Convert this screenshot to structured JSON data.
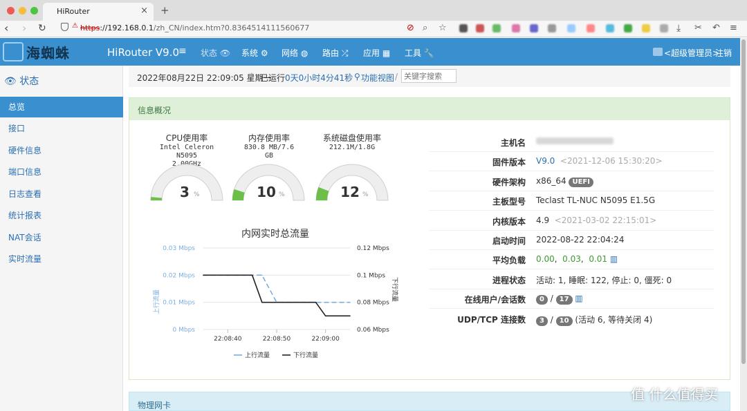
{
  "browser": {
    "tab_title": "HiRouter",
    "url_https": "https",
    "url_host": "://192.168.0.1",
    "url_path": "/zh_CN/index.htm?0.8364514111560677"
  },
  "header": {
    "logo_text": "海蜘蛛",
    "brand": "HiRouter V9.0",
    "menu": [
      {
        "label": "状态 👁"
      },
      {
        "label": "系统 ⚙"
      },
      {
        "label": "网络 ◍"
      },
      {
        "label": "路由 ⤮"
      },
      {
        "label": "应用 ▦"
      },
      {
        "label": "工具 🔧"
      }
    ],
    "user_label": "<超级管理员>",
    "logout": "注销"
  },
  "sidebar": {
    "title": "状态",
    "items": [
      {
        "label": "总览"
      },
      {
        "label": "接口"
      },
      {
        "label": "硬件信息"
      },
      {
        "label": "端口信息"
      },
      {
        "label": "日志查看"
      },
      {
        "label": "统计报表"
      },
      {
        "label": "NAT会话"
      },
      {
        "label": "实时流量"
      }
    ]
  },
  "breadcrumb": {
    "datetime": "2022年08月22日 22:09:05 星期一",
    "uptime_label": "已运行",
    "uptime": "0天0小时4分41秒",
    "func_view": "功能视图",
    "search_placeholder": "关键字搜索"
  },
  "overview": {
    "title": "信息概况",
    "gauges": [
      {
        "title": "CPU使用率",
        "sub": [
          "Intel Celeron",
          "N5095",
          "2.00GHz"
        ],
        "value": "3",
        "unit": "%",
        "fraction": 0.03
      },
      {
        "title": "内存使用率",
        "sub": [
          "830.8 MB/7.6",
          "GB"
        ],
        "value": "10",
        "unit": "%",
        "fraction": 0.1
      },
      {
        "title": "系统磁盘使用率",
        "sub": [
          "212.1M/1.8G"
        ],
        "value": "12",
        "unit": "%",
        "fraction": 0.12
      }
    ],
    "info": {
      "hostname_label": "主机名",
      "firmware_label": "固件版本",
      "firmware": "V9.0",
      "firmware_date": "<2021-12-06 15:30:20>",
      "arch_label": "硬件架构",
      "arch": "x86_64",
      "arch_badge": "UEFI",
      "board_label": "主板型号",
      "board": "Teclast TL-NUC N5095 E1.5G",
      "kernel_label": "内核版本",
      "kernel": "4.9",
      "kernel_date": "<2021-03-02 22:15:01>",
      "boot_label": "启动时间",
      "boot": "2022-08-22 22:04:24",
      "load_label": "平均负载",
      "load": [
        "0.00",
        "0.03",
        "0.01"
      ],
      "proc_label": "进程状态",
      "proc": "活动: 1,  睡眠: 122,  停止: 0,  僵死: 0",
      "users_label": "在线用户/会话数",
      "users": "0",
      "sessions": "17",
      "conn_label": "UDP/TCP 连接数",
      "udp": "3",
      "tcp": "10",
      "conn_detail": "(活动 6, 等待关闭 4)"
    }
  },
  "chart_data": {
    "type": "line",
    "title": "内网实时总流量",
    "x": [
      "22:08:35",
      "22:08:40",
      "22:08:45",
      "22:08:47",
      "22:08:50",
      "22:08:55",
      "22:08:58",
      "22:09:00",
      "22:09:05"
    ],
    "xticks": [
      "22:08:40",
      "22:08:50",
      "22:09:00"
    ],
    "y_left_label": "上行流量",
    "y_left_ticks": [
      "0.03 Mbps",
      "0.02 Mbps",
      "0.01 Mbps",
      "0 Mbps"
    ],
    "y_left_range": [
      0,
      0.03
    ],
    "y_right_label": "下行流量",
    "y_right_ticks": [
      "0.12 Mbps",
      "0.1 Mbps",
      "0.08 Mbps",
      "0.06 Mbps"
    ],
    "y_right_range": [
      0.06,
      0.12
    ],
    "series": [
      {
        "name": "上行流量",
        "axis": "left",
        "color": "#7aaee0",
        "dash": true,
        "values": [
          0.02,
          0.02,
          0.02,
          0.02,
          0.01,
          0.01,
          0.01,
          0.01,
          0.01
        ]
      },
      {
        "name": "下行流量",
        "axis": "right",
        "color": "#222222",
        "dash": false,
        "values": [
          0.1,
          0.1,
          0.1,
          0.08,
          0.08,
          0.08,
          0.08,
          0.07,
          0.07
        ]
      }
    ]
  },
  "physical_nic": {
    "title": "物理网卡"
  },
  "watermark": "值 什么值得买"
}
